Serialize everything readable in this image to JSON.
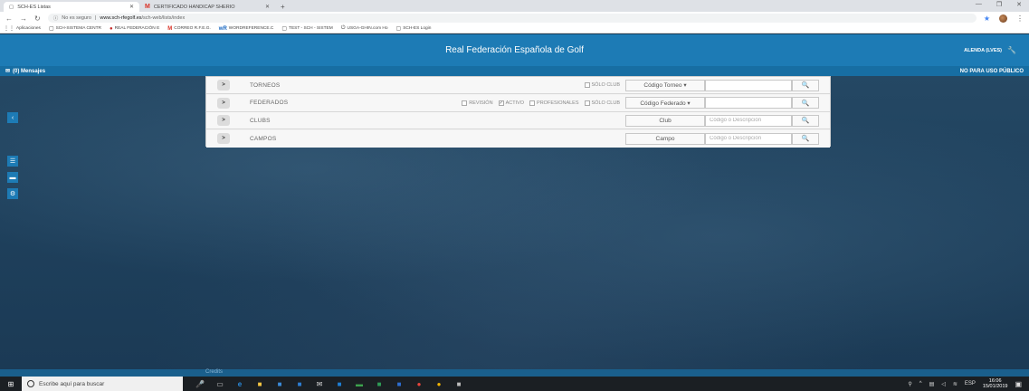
{
  "browser": {
    "tabs": [
      {
        "title": "SCH-ES Listas",
        "active": true
      },
      {
        "title": "CERTIFICADO HANDICAP SHERIO",
        "active": false
      }
    ],
    "security_label": "No es seguro",
    "url_host": "www.sch-rfegolf.es",
    "url_path": "/sch-web/lists/index",
    "bookmarks": [
      {
        "label": "Aplicaciones",
        "icon": "apps-icon"
      },
      {
        "label": "SCH-SISTEMA CENTR",
        "icon": "page-icon"
      },
      {
        "label": "REAL FEDERACIÓN E",
        "icon": "rfeg-icon"
      },
      {
        "label": "CORREO R.F.E.G.",
        "icon": "gmail-icon"
      },
      {
        "label": "WORDREFERENCE.C",
        "icon": "wr-icon"
      },
      {
        "label": "TEST - SCH - SISTEM",
        "icon": "page-icon"
      },
      {
        "label": "USGA-GHIN.com Ho",
        "icon": "usga-icon"
      },
      {
        "label": "SCH-ES Login",
        "icon": "page-icon"
      }
    ]
  },
  "app": {
    "title": "Real Federación Española de Golf",
    "user": "ALENDA (LVES)",
    "messages": "(0) Mensajes",
    "notice": "NO PARA USO PÚBLICO",
    "credits": "Credits"
  },
  "panel": {
    "rows": [
      {
        "label": "TORNEOS",
        "checks": [
          {
            "label": "SÓLO CLUB",
            "checked": false
          }
        ],
        "field_button": "Código Torneo ▾",
        "placeholder": ""
      },
      {
        "label": "FEDERADOS",
        "checks": [
          {
            "label": "REVISIÓN",
            "checked": false
          },
          {
            "label": "ACTIVO",
            "checked": true
          },
          {
            "label": "PROFESIONALES",
            "checked": false
          },
          {
            "label": "SÓLO CLUB",
            "checked": false
          }
        ],
        "field_button": "Código Federado ▾",
        "placeholder": ""
      },
      {
        "label": "CLUBS",
        "checks": [],
        "field_button": "Club",
        "placeholder": "Código o Descripción"
      },
      {
        "label": "CAMPOS",
        "checks": [],
        "field_button": "Campo",
        "placeholder": "Código o Descripción"
      }
    ]
  },
  "taskbar": {
    "search_placeholder": "Escribe aquí para buscar",
    "lang": "ESP",
    "time": "16:06",
    "date": "15/01/2019"
  },
  "colors": {
    "header": "#1d7bb5",
    "subbar": "#176ea3",
    "background": "#1c3c55"
  }
}
